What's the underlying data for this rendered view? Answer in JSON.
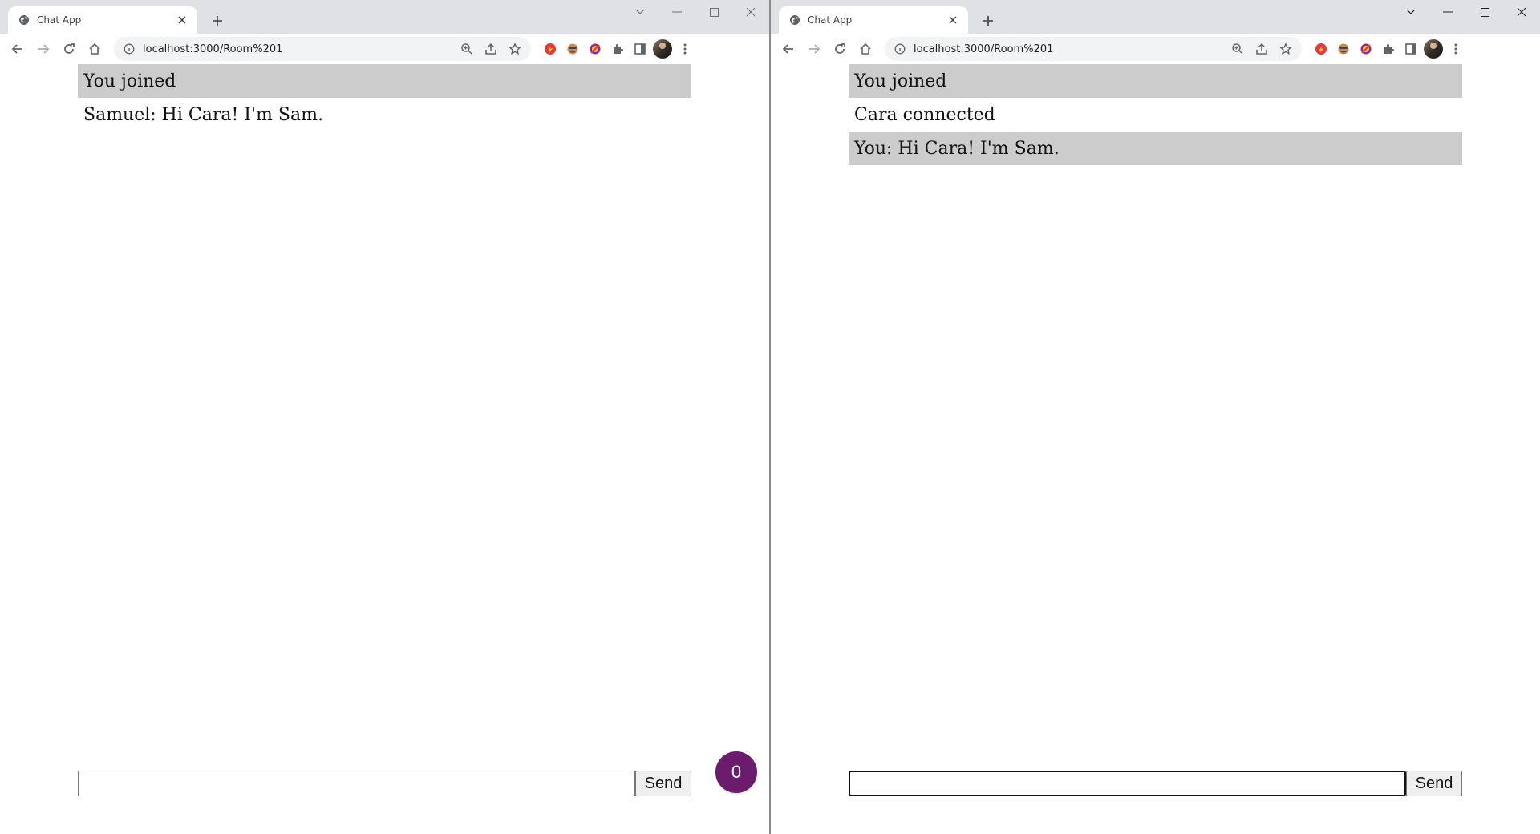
{
  "windows": [
    {
      "id": "left",
      "tab_title": "Chat App",
      "url": "localhost:3000/Room%201",
      "messages": [
        {
          "text": "You joined",
          "shaded": true
        },
        {
          "text": "Samuel: Hi Cara! I'm Sam.",
          "shaded": false
        }
      ],
      "input_value": "",
      "send_label": "Send",
      "online_count": "0"
    },
    {
      "id": "right",
      "tab_title": "Chat App",
      "url": "localhost:3000/Room%201",
      "messages": [
        {
          "text": "You joined",
          "shaded": true
        },
        {
          "text": "Cara connected",
          "shaded": false
        },
        {
          "text": "You: Hi Cara! I'm Sam.",
          "shaded": true
        }
      ],
      "input_value": "",
      "send_label": "Send"
    }
  ],
  "icons": {
    "favicon": "globe-icon",
    "close": "close-icon",
    "new_tab": "plus-icon",
    "back": "back-arrow-icon",
    "forward": "forward-arrow-icon",
    "reload": "reload-icon",
    "home": "home-icon",
    "site_info": "info-icon",
    "zoom": "zoom-icon",
    "share": "share-icon",
    "bookmark": "star-icon",
    "extensions": "puzzle-icon",
    "side_panel": "side-panel-icon",
    "menu": "kebab-menu-icon"
  },
  "colors": {
    "shaded_message_bg": "#cccccc",
    "badge_bg": "#6a1b6c",
    "browser_frame": "#dfe1e5"
  }
}
